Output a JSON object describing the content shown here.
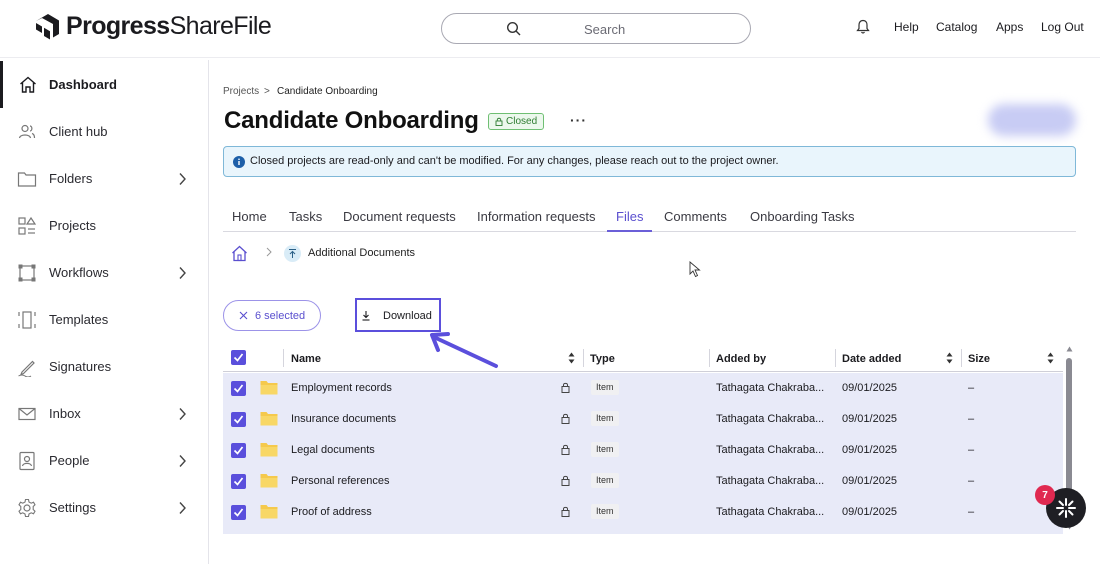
{
  "header": {
    "brand_progress": "Progress",
    "brand_sharefile": "ShareFile",
    "search_placeholder": "Search",
    "nav": [
      "Help",
      "Catalog",
      "Apps",
      "Log Out"
    ]
  },
  "sidebar": {
    "items": [
      {
        "label": "Dashboard",
        "icon": "home-icon",
        "active": true,
        "chevron": false
      },
      {
        "label": "Client hub",
        "icon": "people-icon",
        "active": false,
        "chevron": false
      },
      {
        "label": "Folders",
        "icon": "folder-icon",
        "active": false,
        "chevron": true
      },
      {
        "label": "Projects",
        "icon": "projects-icon",
        "active": false,
        "chevron": false
      },
      {
        "label": "Workflows",
        "icon": "workflow-icon",
        "active": false,
        "chevron": true
      },
      {
        "label": "Templates",
        "icon": "template-icon",
        "active": false,
        "chevron": false
      },
      {
        "label": "Signatures",
        "icon": "pen-icon",
        "active": false,
        "chevron": false
      },
      {
        "label": "Inbox",
        "icon": "mail-icon",
        "active": false,
        "chevron": true
      },
      {
        "label": "People",
        "icon": "person-icon",
        "active": false,
        "chevron": true
      },
      {
        "label": "Settings",
        "icon": "gear-icon",
        "active": false,
        "chevron": true
      }
    ]
  },
  "breadcrumb": {
    "root": "Projects",
    "sep": ">",
    "current": "Candidate Onboarding"
  },
  "project": {
    "title": "Candidate Onboarding",
    "status": "Closed",
    "more": "···"
  },
  "banner": {
    "text": "Closed projects are read-only and can't be modified. For any changes, please reach out to the project owner."
  },
  "tabs": [
    "Home",
    "Tasks",
    "Document requests",
    "Information requests",
    "Files",
    "Comments",
    "Onboarding Tasks"
  ],
  "active_tab": "Files",
  "folder_path": {
    "current": "Additional Documents"
  },
  "toolbar": {
    "selected_label": "6 selected",
    "download_label": "Download"
  },
  "table": {
    "columns": [
      "Name",
      "Type",
      "Added by",
      "Date added",
      "Size"
    ],
    "rows": [
      {
        "name": "Employment records",
        "type": "Item",
        "added_by": "Tathagata Chakraba...",
        "date": "09/01/2025",
        "size": "–"
      },
      {
        "name": "Insurance documents",
        "type": "Item",
        "added_by": "Tathagata Chakraba...",
        "date": "09/01/2025",
        "size": "–"
      },
      {
        "name": "Legal documents",
        "type": "Item",
        "added_by": "Tathagata Chakraba...",
        "date": "09/01/2025",
        "size": "–"
      },
      {
        "name": "Personal references",
        "type": "Item",
        "added_by": "Tathagata Chakraba...",
        "date": "09/01/2025",
        "size": "–"
      },
      {
        "name": "Proof of address",
        "type": "Item",
        "added_by": "Tathagata Chakraba...",
        "date": "09/01/2025",
        "size": "–"
      }
    ]
  },
  "assistant": {
    "badge_count": "7"
  },
  "colors": {
    "accent": "#5a4fdc",
    "row_selected": "#e8eaf8",
    "closed_badge": "#2f7d32",
    "banner_bg": "#e9f5fc"
  }
}
